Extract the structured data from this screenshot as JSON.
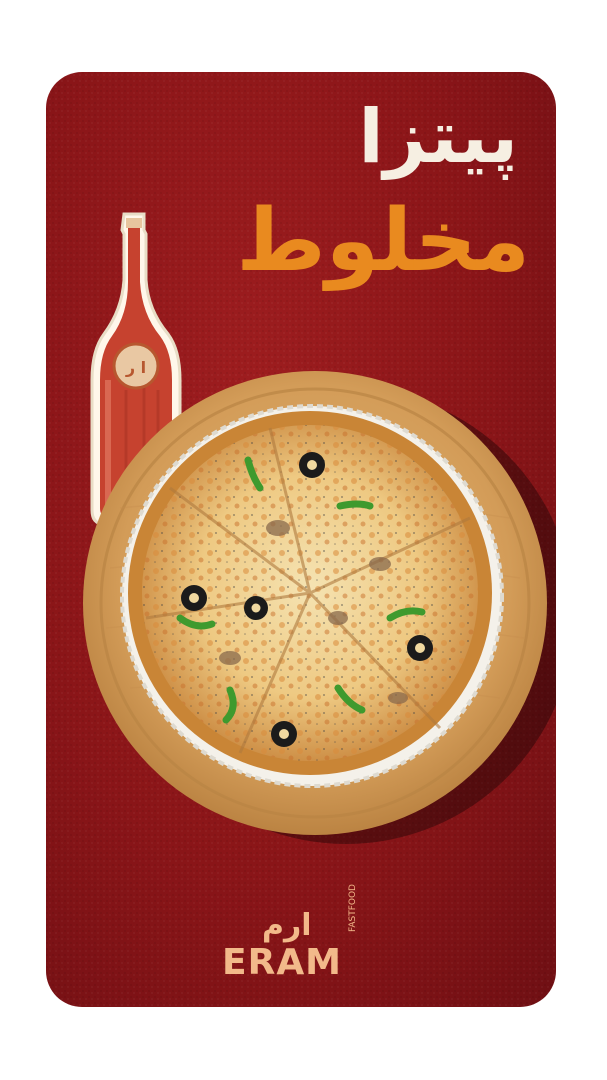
{
  "title": {
    "line1": "پیتزا",
    "line2": "مخلوط"
  },
  "brand": {
    "name_fa": "ارم",
    "name_en": "ERAM",
    "tagline": "FASTFOOD"
  },
  "colors": {
    "background": "#8a1518",
    "title_primary": "#f6efe2",
    "title_accent": "#e98a1f",
    "logo": "#f2b98a"
  },
  "icons": [
    "soda-bottle",
    "pizza",
    "wooden-board"
  ]
}
